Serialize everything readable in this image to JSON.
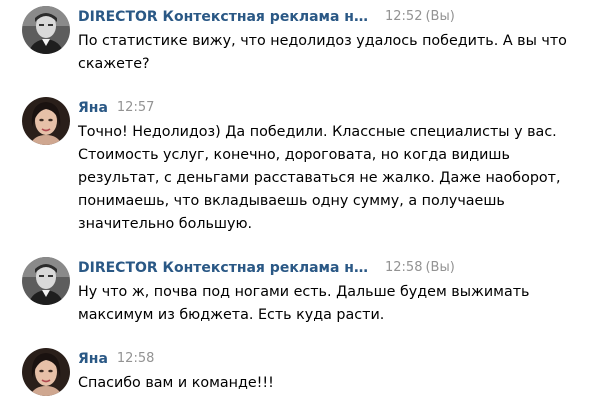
{
  "messages": [
    {
      "author": "DIRECTOR Контекстная реклама на Яндекс",
      "time": "12:52",
      "time_suffix": "(Вы)",
      "avatar_icon": "male-avatar-icon",
      "text": "По статистике вижу, что недолидоз удалось победить. А вы что скажете?"
    },
    {
      "author": "Яна",
      "time": "12:57",
      "avatar_icon": "female-avatar-icon",
      "text": "Точно! Недолидоз) Да победили. Классные специалисты у вас. Стоимость услуг, конечно, дороговата, но когда видишь результат, с деньгами расставаться не жалко. Даже наоборот, понимаешь, что вкладываешь одну сумму, а получаешь значительно большую."
    },
    {
      "author": "DIRECTOR Контекстная реклама на Яндекс",
      "time": "12:58",
      "time_suffix": "(Вы)",
      "avatar_icon": "male-avatar-icon",
      "text": "Ну что ж, почва под ногами есть. Дальше будем выжимать максимум из бюджета. Есть куда расти."
    },
    {
      "author": "Яна",
      "time": "12:58",
      "avatar_icon": "female-avatar-icon",
      "text": "Спасибо вам и команде!!!"
    }
  ]
}
